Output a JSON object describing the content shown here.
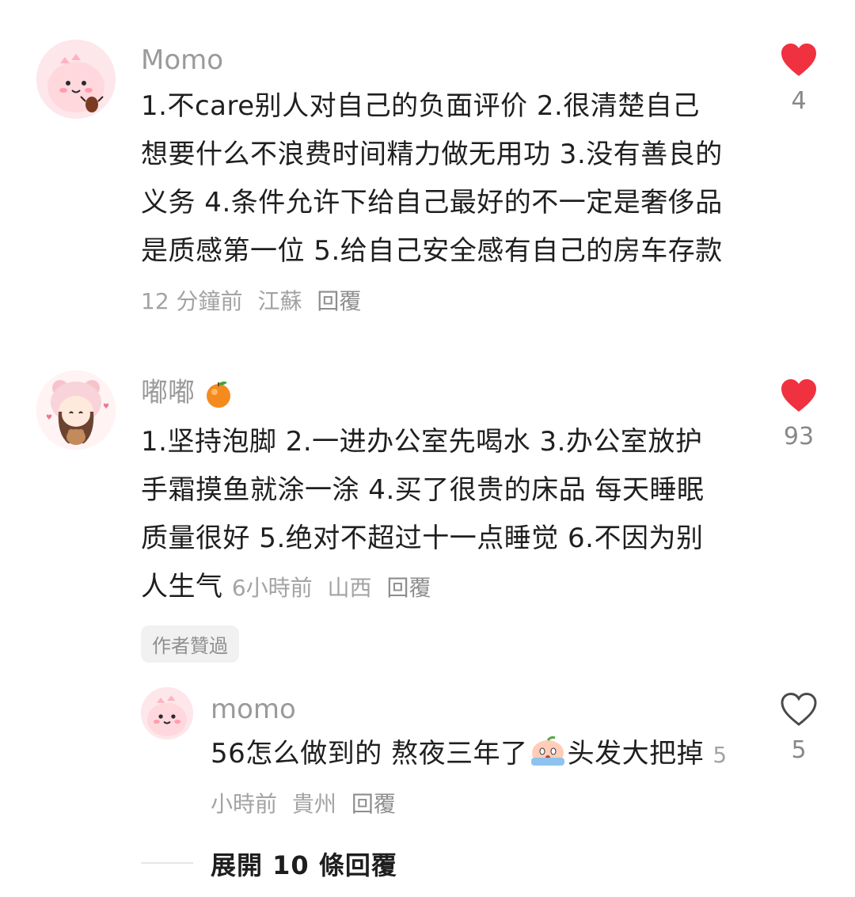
{
  "comments": [
    {
      "username": "Momo",
      "text": "1.不care别人对自己的负面评价 2.很清楚自己想要什么不浪费时间精力做无用功 3.没有善良的义务 4.条件允许下给自己最好的不一定是奢侈品是质感第一位 5.给自己安全感有自己的房车存款",
      "time": "12 分鐘前",
      "location": "江蘇",
      "reply_label": "回覆",
      "like_count": "4",
      "liked": true
    },
    {
      "username": "嘟嘟",
      "username_emoji": "orange-emoji",
      "text": "1.坚持泡脚 2.一进办公室先喝水 3.办公室放护手霜摸鱼就涂一涂 4.买了很贵的床品 每天睡眠质量很好 5.绝对不超过十一点睡觉 6.不因为别人生气",
      "time": "6小時前",
      "location": "山西",
      "reply_label": "回覆",
      "like_count": "93",
      "liked": true,
      "badge": "作者贊過"
    }
  ],
  "reply": {
    "username": "momo",
    "text_before_emoji": "56怎么做到的  熬夜三年了",
    "emoji": "crying-peach-emoji",
    "text_after_emoji": "头发大把掉",
    "time": "5小時前",
    "location": "貴州",
    "reply_label": "回覆",
    "like_count": "5",
    "liked": false
  },
  "expand_replies_label": "展開 10 條回覆",
  "colors": {
    "heart_red": "#f0313f",
    "meta_gray": "#a3a3a3",
    "text": "#1f1f1f"
  }
}
